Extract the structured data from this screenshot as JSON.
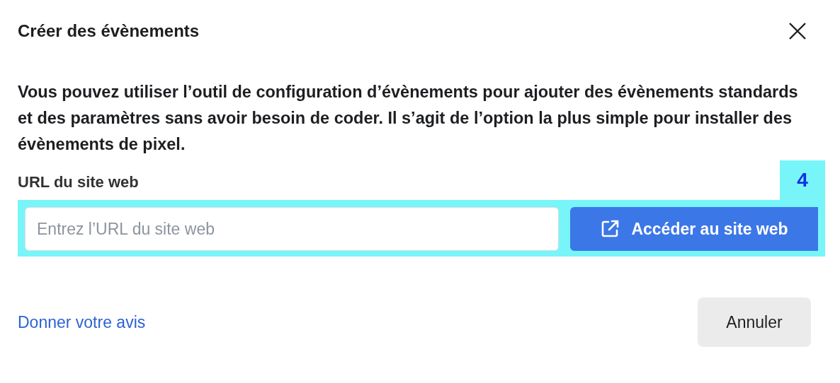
{
  "dialog": {
    "title": "Créer des évènements",
    "description": "Vous pouvez utiliser l’outil de configuration d’évènements pour ajouter des évènements standards et des paramètres sans avoir besoin de coder. Il s’agit de l’option la plus simple pour installer des évènements de pixel.",
    "url_field": {
      "label": "URL du site web",
      "placeholder": "Entrez l’URL du site web"
    },
    "open_button": {
      "label": "Accéder au site web"
    },
    "annotation": {
      "label": "4"
    },
    "feedback_link": "Donner votre avis",
    "cancel_button": {
      "label": "Annuler"
    }
  }
}
